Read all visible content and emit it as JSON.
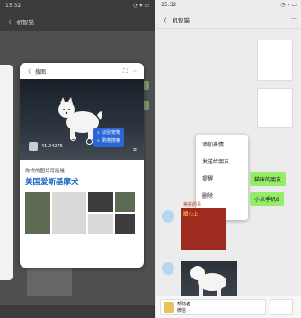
{
  "left": {
    "status_time": "15:32",
    "status_icons": "◔ ▾ ▭",
    "nav_back": "〈",
    "nav_title": "机智猫",
    "card": {
      "back": "〈",
      "title": "搜图",
      "icon_expand": "⛶",
      "icon_more": "⋯",
      "menu_items": [
        "识别宠物",
        "购物搜索"
      ],
      "tag_text": "41:04275",
      "result_label": "你找的图片可能是：",
      "result_title": "美国爱斯基摩犬"
    }
  },
  "right": {
    "status_time": "15:32",
    "status_icons": "◔ ▾ ▭",
    "nav_back": "〈",
    "nav_title": "机智猫",
    "nav_more": "···",
    "context_menu": [
      "添加表情",
      "发送给朋友",
      "提醒",
      "删除",
      "更多"
    ],
    "green_buttons": [
      "猫咪的朋友",
      "小米手机8"
    ],
    "sticker_name": "美好的事",
    "sticker_text": "暖心上",
    "bottom_card": {
      "title": "帮助者",
      "subtitle": "微信"
    }
  }
}
